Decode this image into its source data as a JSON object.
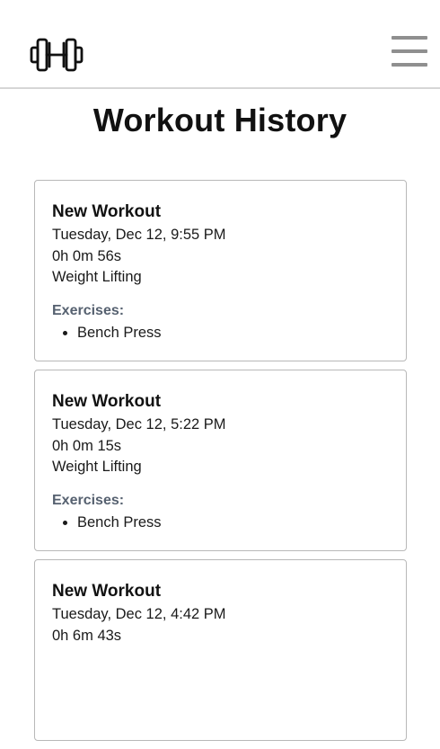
{
  "header": {
    "logo_icon": "dumbbell-icon",
    "menu_icon": "hamburger-menu-icon"
  },
  "page": {
    "title": "Workout History"
  },
  "workouts": [
    {
      "title": "New Workout",
      "date": "Tuesday, Dec 12, 9:55 PM",
      "duration": "0h 0m 56s",
      "type": "Weight Lifting",
      "exercises_label": "Exercises:",
      "exercises": [
        "Bench Press"
      ]
    },
    {
      "title": "New Workout",
      "date": "Tuesday, Dec 12, 5:22 PM",
      "duration": "0h 0m 15s",
      "type": "Weight Lifting",
      "exercises_label": "Exercises:",
      "exercises": [
        "Bench Press"
      ]
    },
    {
      "title": "New Workout",
      "date": "Tuesday, Dec 12, 4:42 PM",
      "duration": "0h 6m 43s",
      "type": "",
      "exercises_label": "",
      "exercises": []
    }
  ]
}
